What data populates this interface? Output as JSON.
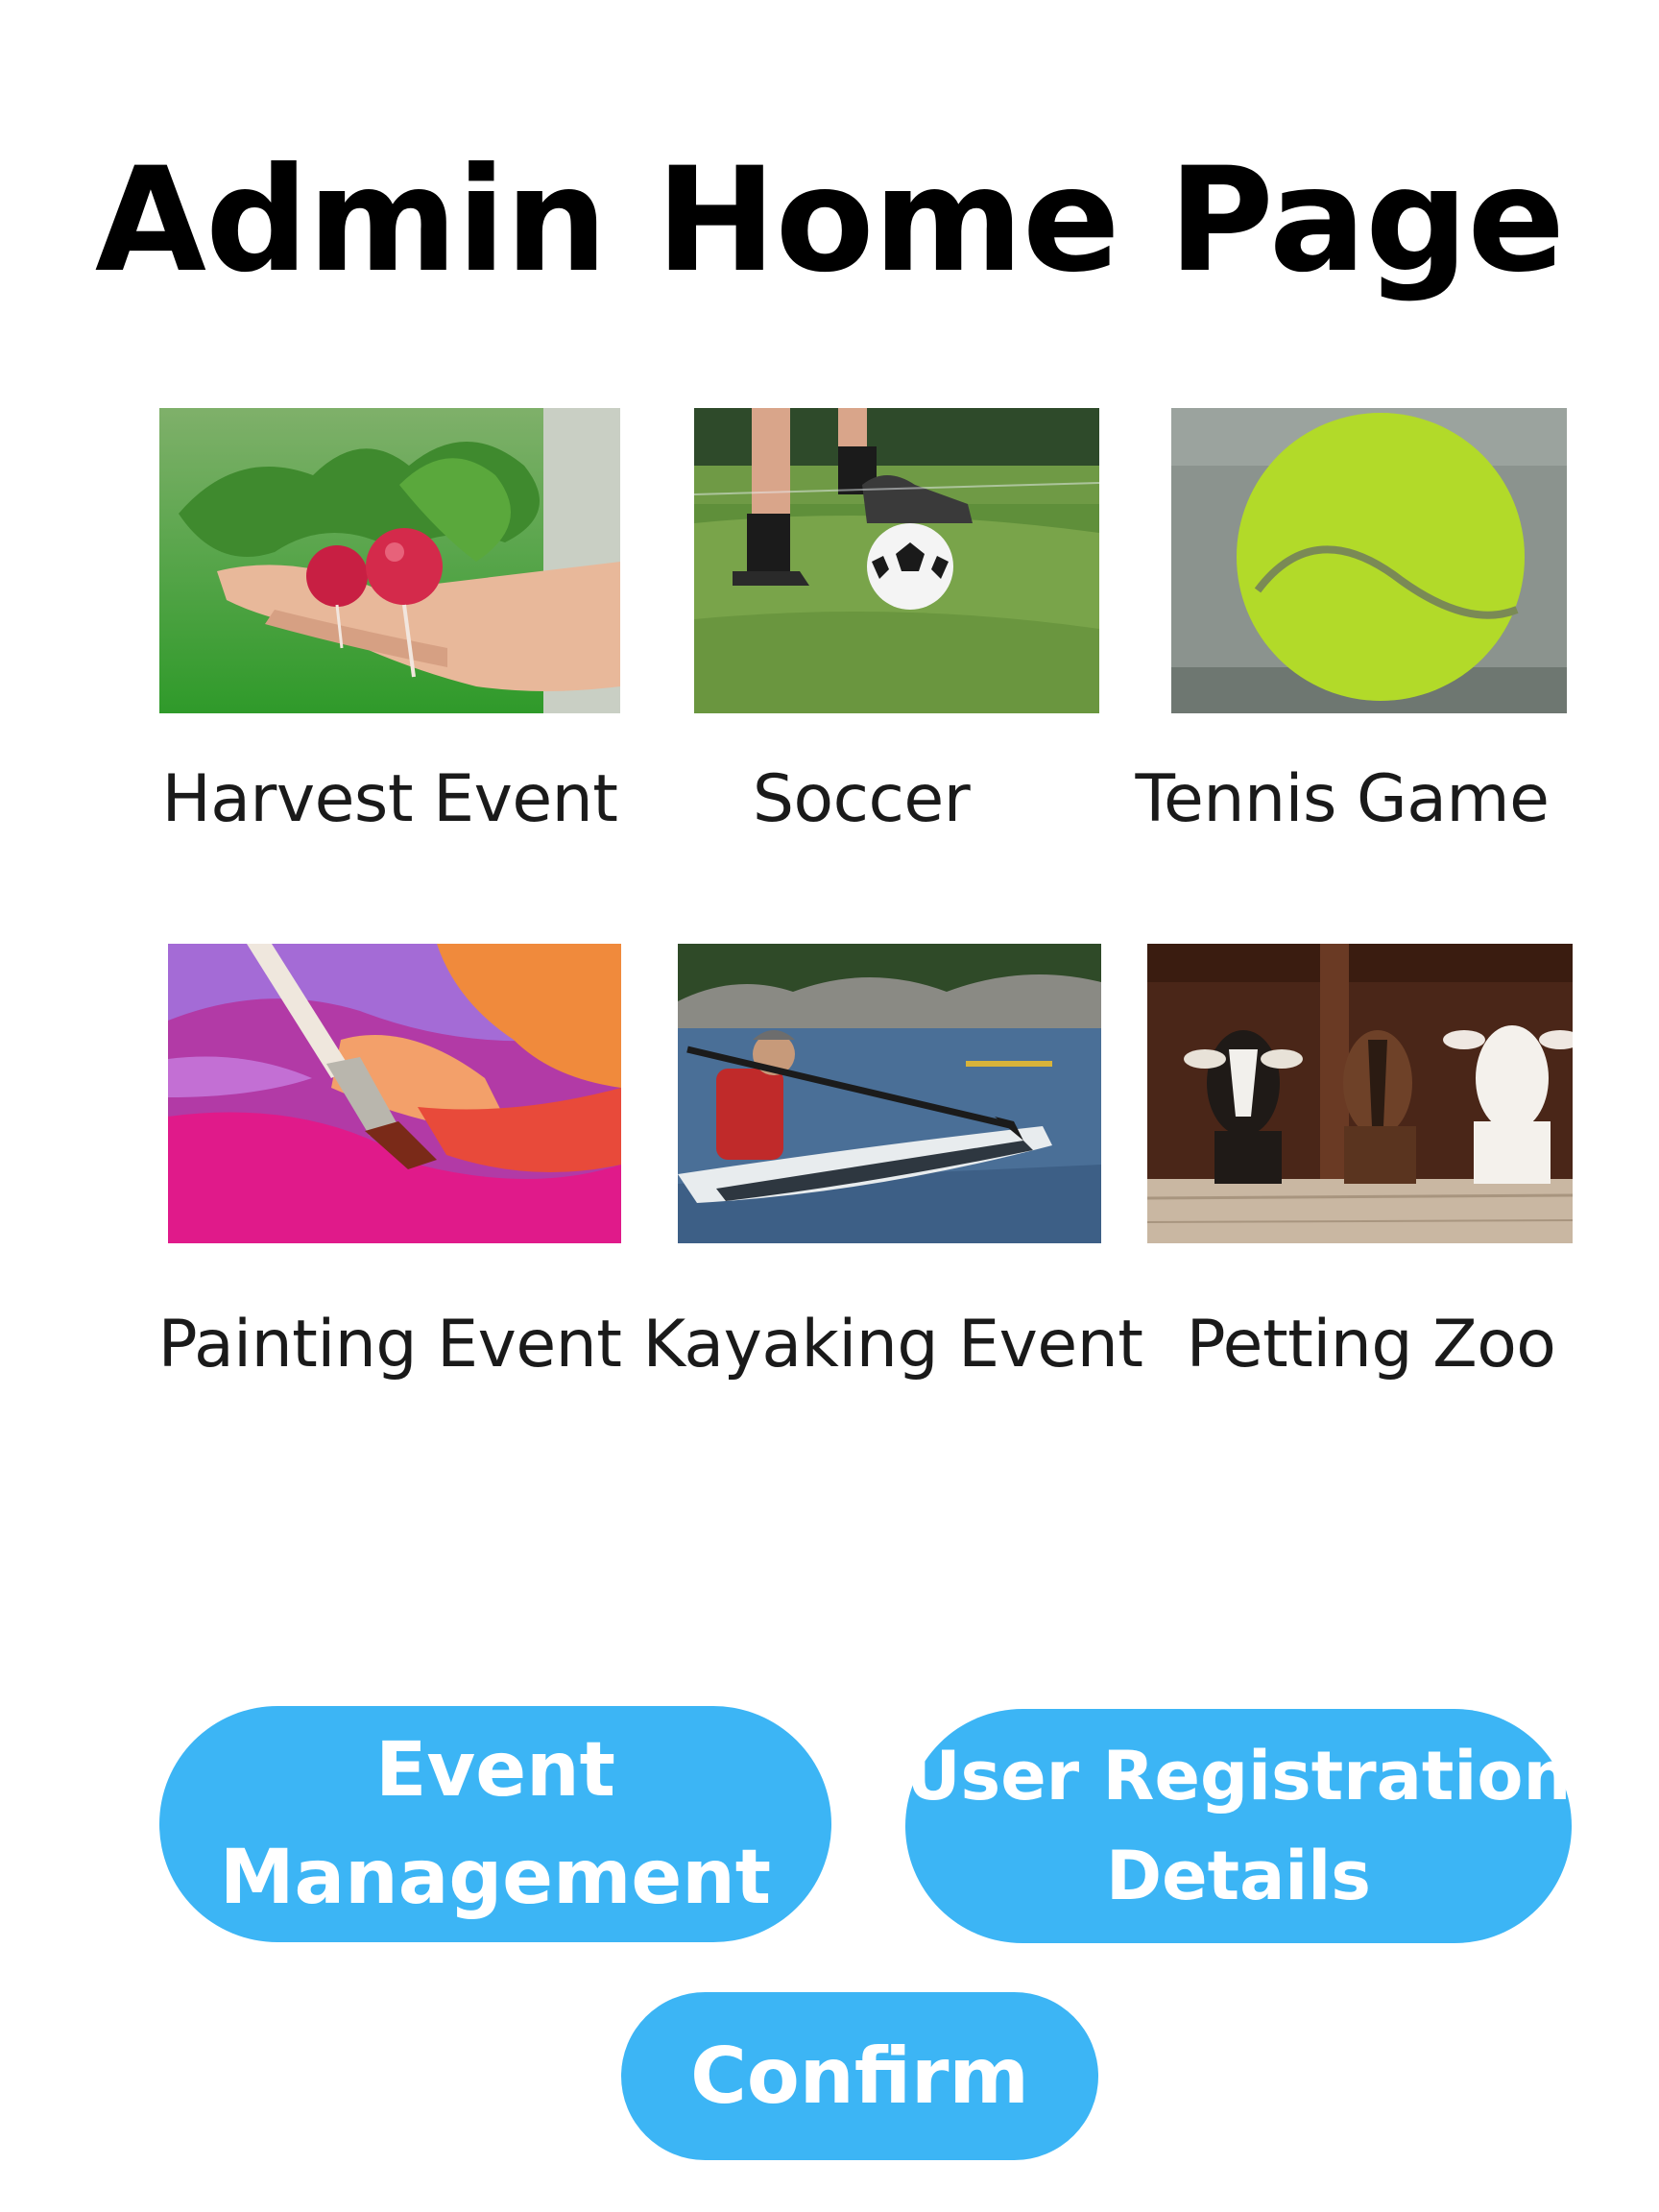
{
  "header": {
    "title": "Admin Home Page"
  },
  "events": [
    {
      "label": "Harvest Event",
      "image": "radishes-in-hand-photo"
    },
    {
      "label": "Soccer",
      "image": "soccer-ball-photo"
    },
    {
      "label": "Tennis Game",
      "image": "tennis-ball-photo"
    },
    {
      "label": "Painting Event",
      "image": "paintbrush-photo"
    },
    {
      "label": "Kayaking Event",
      "image": "kayaker-on-lake-photo"
    },
    {
      "label": "Petting Zoo",
      "image": "goats-photo"
    }
  ],
  "actions": {
    "event_management_line1": "Event",
    "event_management_line2": "Management",
    "user_registration_line1": "User Registration",
    "user_registration_line2": "Details",
    "confirm": "Confirm"
  },
  "colors": {
    "button": "#3cb5f5",
    "button_text": "#ffffff",
    "title": "#000000"
  }
}
